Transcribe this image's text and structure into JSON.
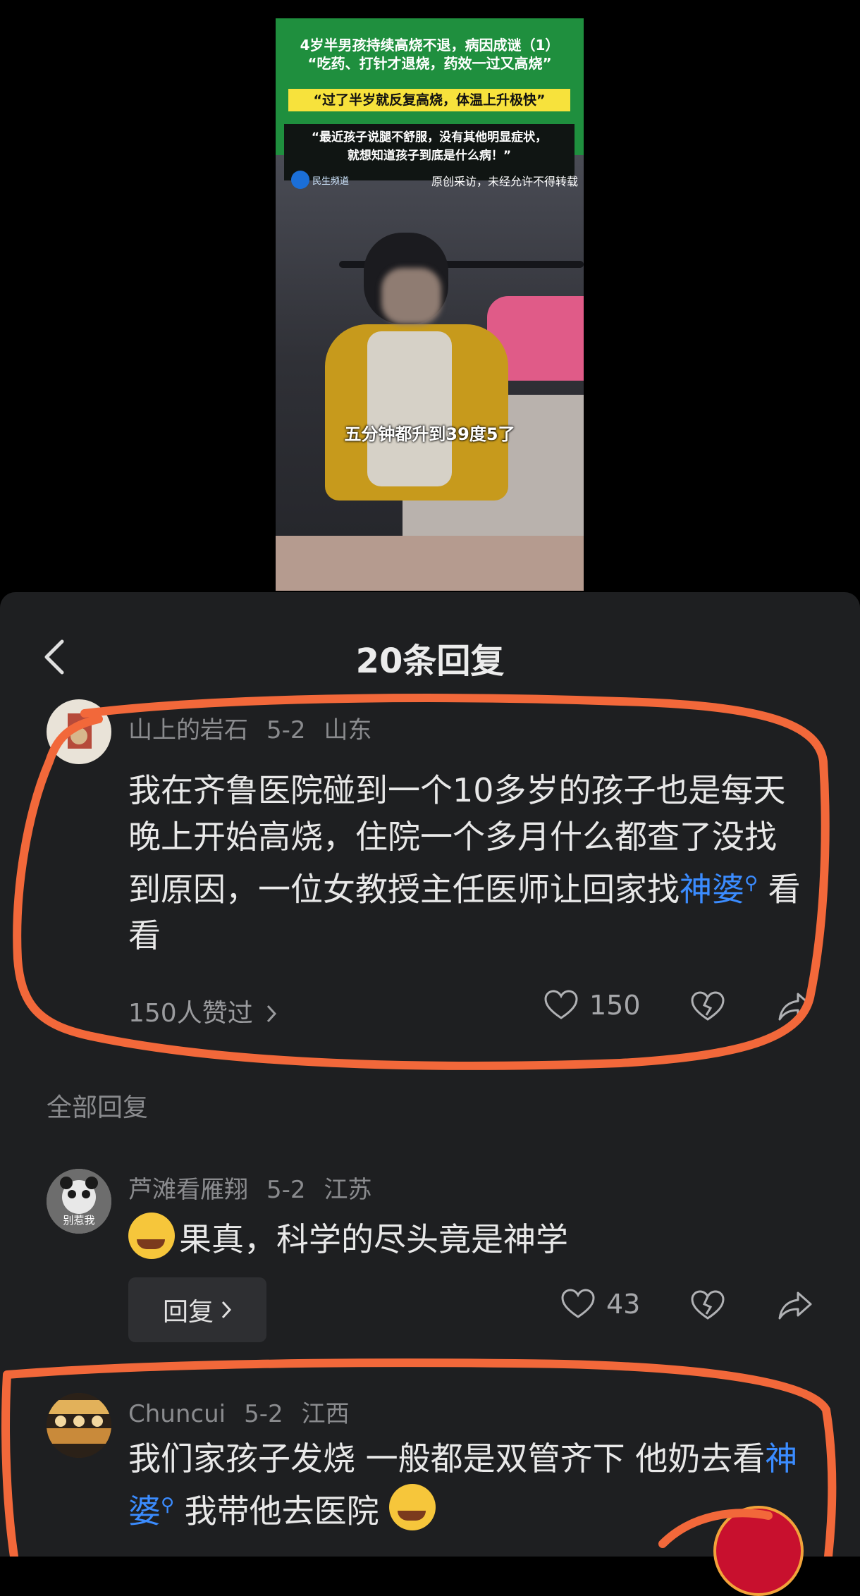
{
  "video": {
    "title_line1": "4岁半男孩持续高烧不退，病因成谜（1）",
    "title_line2": "“吃药、打针才退烧，药效一过又高烧”",
    "highlight": "“过了半岁就反复高烧，体温上升极快”",
    "quote_line1": "“最近孩子说腿不舒服，没有其他明显症状，",
    "quote_line2": "就想知道孩子到底是什么病！”",
    "logo": "民生频道",
    "notice": "原创采访，未经允许不得转载",
    "subtitle": "五分钟都升到39度5了"
  },
  "sheet": {
    "title": "20条回复"
  },
  "main_comment": {
    "user": "山上的岩石",
    "date": "5-2",
    "location": "山东",
    "text_pre": "我在齐鲁医院碰到一个10多岁的孩子也是每天晚上开始高烧，住院一个多月什么都查了没找到原因，一位女教授主任医师让回家找",
    "text_link": "神婆",
    "text_post": " 看看",
    "liked_by": "150人赞过",
    "like_count": "150"
  },
  "section_label": "全部回复",
  "replies": [
    {
      "user": "芦滩看雁翔",
      "date": "5-2",
      "location": "江苏",
      "avatar_text": "别惹我",
      "text": "果真，科学的尽头竟是神学",
      "reply_label": "回复",
      "like_count": "43"
    },
    {
      "user": "Chuncui",
      "date": "5-2",
      "location": "江西",
      "text_pre": "我们家孩子发烧 一般都是双管齐下 他奶去看",
      "text_link": "神婆",
      "text_post": " 我带他去医院"
    }
  ],
  "colors": {
    "sheet_bg": "#1e1f21",
    "link": "#3b8cff",
    "annotation": "#f2683a",
    "video_header": "#1f8f3e"
  },
  "icons": [
    "back-chevron-icon",
    "heart-icon",
    "broken-heart-icon",
    "share-icon",
    "chevron-right-icon",
    "search-icon"
  ]
}
